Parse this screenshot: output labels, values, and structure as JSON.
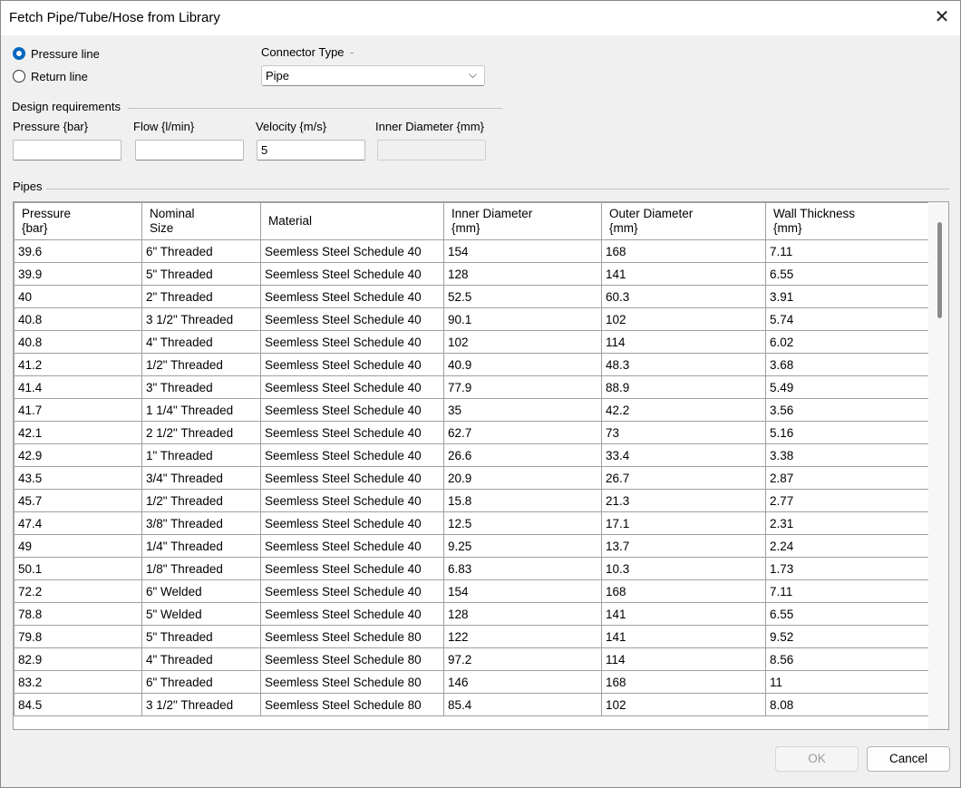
{
  "window": {
    "title": "Fetch Pipe/Tube/Hose from Library",
    "close_glyph": "✕"
  },
  "line_selection": {
    "options": [
      {
        "label": "Pressure line",
        "checked": true
      },
      {
        "label": "Return line",
        "checked": false
      }
    ]
  },
  "connector": {
    "label": "Connector Type",
    "dash": "-",
    "value": "Pipe",
    "chevron": "⌵"
  },
  "design": {
    "group_label": "Design requirements",
    "fields": [
      {
        "label": "Pressure {bar}",
        "value": ""
      },
      {
        "label": "Flow {l/min}",
        "value": ""
      },
      {
        "label": "Velocity {m/s}",
        "value": "5"
      },
      {
        "label": "Inner Diameter {mm}",
        "value": ""
      }
    ]
  },
  "pipes": {
    "group_label": "Pipes",
    "columns": [
      "Pressure\n{bar}",
      "Nominal\nSize",
      "Material",
      "Inner Diameter\n{mm}",
      "Outer Diameter\n{mm}",
      "Wall Thickness\n{mm}"
    ],
    "rows": [
      [
        "39.6",
        "6\" Threaded",
        "Seemless Steel Schedule 40",
        "154",
        "168",
        "7.11"
      ],
      [
        "39.9",
        "5\" Threaded",
        "Seemless Steel Schedule 40",
        "128",
        "141",
        "6.55"
      ],
      [
        "40",
        "2\" Threaded",
        "Seemless Steel Schedule 40",
        "52.5",
        "60.3",
        "3.91"
      ],
      [
        "40.8",
        "3 1/2\" Threaded",
        "Seemless Steel Schedule 40",
        "90.1",
        "102",
        "5.74"
      ],
      [
        "40.8",
        "4\" Threaded",
        "Seemless Steel Schedule 40",
        "102",
        "114",
        "6.02"
      ],
      [
        "41.2",
        "1/2\" Threaded",
        "Seemless Steel Schedule 40",
        "40.9",
        "48.3",
        "3.68"
      ],
      [
        "41.4",
        "3\" Threaded",
        "Seemless Steel Schedule 40",
        "77.9",
        "88.9",
        "5.49"
      ],
      [
        "41.7",
        "1 1/4\" Threaded",
        "Seemless Steel Schedule 40",
        "35",
        "42.2",
        "3.56"
      ],
      [
        "42.1",
        "2 1/2\" Threaded",
        "Seemless Steel Schedule 40",
        "62.7",
        "73",
        "5.16"
      ],
      [
        "42.9",
        "1\" Threaded",
        "Seemless Steel Schedule 40",
        "26.6",
        "33.4",
        "3.38"
      ],
      [
        "43.5",
        "3/4\" Threaded",
        "Seemless Steel Schedule 40",
        "20.9",
        "26.7",
        "2.87"
      ],
      [
        "45.7",
        "1/2\" Threaded",
        "Seemless Steel Schedule 40",
        "15.8",
        "21.3",
        "2.77"
      ],
      [
        "47.4",
        "3/8\" Threaded",
        "Seemless Steel Schedule 40",
        "12.5",
        "17.1",
        "2.31"
      ],
      [
        "49",
        "1/4\" Threaded",
        "Seemless Steel Schedule 40",
        "9.25",
        "13.7",
        "2.24"
      ],
      [
        "50.1",
        "1/8\" Threaded",
        "Seemless Steel Schedule 40",
        "6.83",
        "10.3",
        "1.73"
      ],
      [
        "72.2",
        "6\" Welded",
        "Seemless Steel Schedule 40",
        "154",
        "168",
        "7.11"
      ],
      [
        "78.8",
        "5\" Welded",
        "Seemless Steel Schedule 40",
        "128",
        "141",
        "6.55"
      ],
      [
        "79.8",
        "5\" Threaded",
        "Seemless Steel Schedule 80",
        "122",
        "141",
        "9.52"
      ],
      [
        "82.9",
        "4\" Threaded",
        "Seemless Steel Schedule 80",
        "97.2",
        "114",
        "8.56"
      ],
      [
        "83.2",
        "6\" Threaded",
        "Seemless Steel Schedule 80",
        "146",
        "168",
        "11"
      ],
      [
        "84.5",
        "3 1/2\" Threaded",
        "Seemless Steel Schedule 80",
        "85.4",
        "102",
        "8.08"
      ]
    ]
  },
  "buttons": {
    "ok": "OK",
    "cancel": "Cancel",
    "ok_enabled": false
  },
  "colors": {
    "accent": "#0067c0",
    "dialog_bg": "#f0f0f0",
    "grid_line": "#a0a0a0"
  }
}
